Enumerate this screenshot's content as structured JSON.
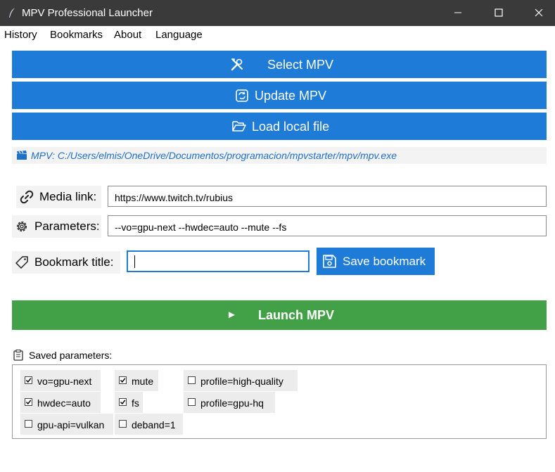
{
  "window": {
    "title": "MPV Professional Launcher",
    "app_icon": "feather-icon"
  },
  "menu": [
    "History",
    "Bookmarks",
    "About",
    "Language"
  ],
  "buttons": {
    "select_mpv": "Select MPV",
    "update_mpv": "Update MPV",
    "load_local_file": "Load local file"
  },
  "mpv_path": "MPV: C:/Users/elmis/OneDrive/Documentos/programacion/mpvstarter/mpv/mpv.exe",
  "form": {
    "media_link_label": "Media link:",
    "media_link_value": "https://www.twitch.tv/rubius",
    "parameters_label": "Parameters:",
    "parameters_value": "--vo=gpu-next --hwdec=auto --mute --fs",
    "bookmark_title_label": "Bookmark title:",
    "bookmark_title_value": "",
    "save_bookmark": "Save bookmark"
  },
  "launch": {
    "arrow": "►",
    "label": "Launch MPV"
  },
  "saved_parameters": {
    "title": "Saved parameters:",
    "items": [
      {
        "label": "vo=gpu-next",
        "checked": true
      },
      {
        "label": "mute",
        "checked": true
      },
      {
        "label": "profile=high-quality",
        "checked": false
      },
      {
        "label": "hwdec=auto",
        "checked": true
      },
      {
        "label": "fs",
        "checked": true
      },
      {
        "label": "profile=gpu-hq",
        "checked": false
      },
      {
        "label": "gpu-api=vulkan",
        "checked": false
      },
      {
        "label": "deband=1",
        "checked": false
      }
    ]
  },
  "colors": {
    "primary": "#1e7bd8",
    "launch": "#42a046",
    "titlebar": "#3a3a3a",
    "path_text": "#1e6fc8"
  }
}
